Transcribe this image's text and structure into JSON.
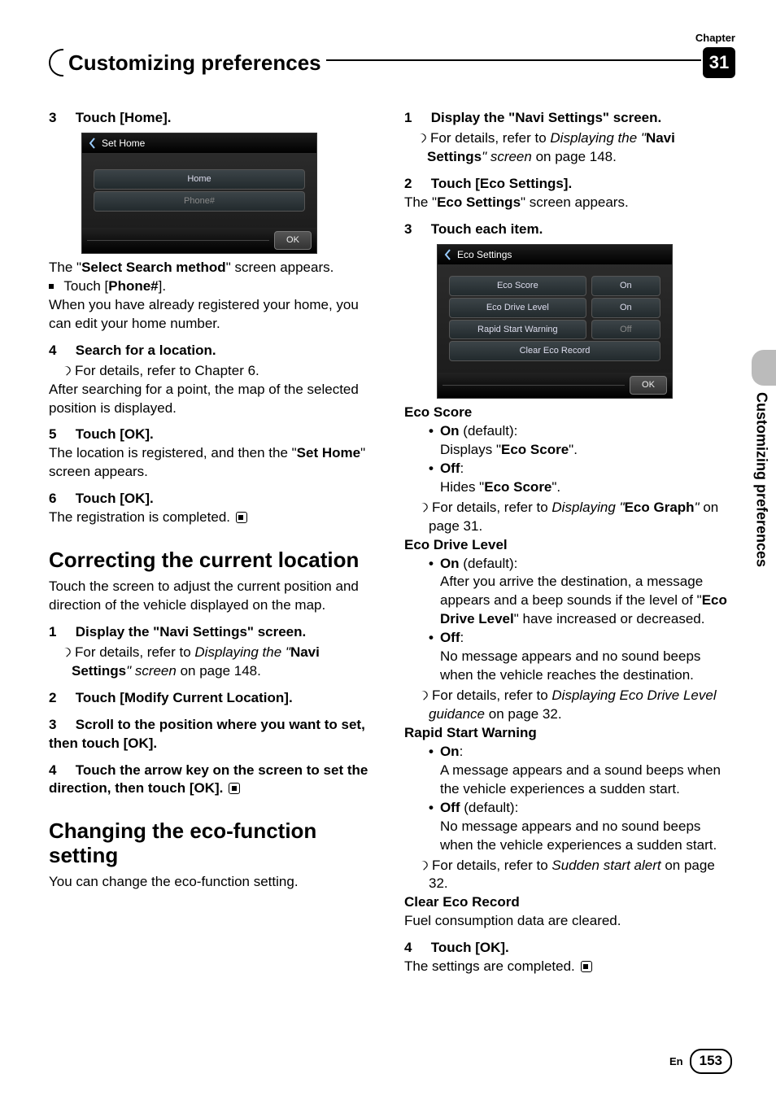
{
  "chapter_label": "Chapter",
  "chapter_number": "31",
  "header_title": "Customizing preferences",
  "side_tab_text": "Customizing preferences",
  "footer_lang": "En",
  "page_number": "153",
  "left": {
    "step3": {
      "num": "3",
      "title": "Touch [Home]."
    },
    "shot1": {
      "title": "Set Home",
      "row1": "Home",
      "row2": "Phone#",
      "ok": "OK"
    },
    "screen_appears": "The \"",
    "screen_appears_bold": "Select Search method",
    "screen_appears_tail": "\" screen appears.",
    "touch_phone": "Touch [",
    "touch_phone_b": "Phone#",
    "touch_phone_tail": "].",
    "note_home": "When you have already registered your home, you can edit your home number.",
    "step4": {
      "num": "4",
      "title": "Search for a location."
    },
    "step4_ref": "For details, refer to Chapter 6.",
    "step4_body": "After searching for a point, the map of the selected position is displayed.",
    "step5": {
      "num": "5",
      "title": "Touch [OK]."
    },
    "step5_body_a": "The location is registered, and then the \"",
    "step5_body_b": "Set Home",
    "step5_body_c": "\" screen appears.",
    "step6": {
      "num": "6",
      "title": "Touch [OK]."
    },
    "step6_body": "The registration is completed.",
    "h2a": "Correcting the current location",
    "h2a_body": "Touch the screen to adjust the current position and direction of the vehicle displayed on the map.",
    "c_step1": {
      "num": "1",
      "title": "Display the \"Navi Settings\" screen."
    },
    "c_step1_a": "For details, refer to ",
    "c_step1_b": "Displaying the \"",
    "c_step1_c": "Navi Settings",
    "c_step1_d": "\" screen",
    "c_step1_e": " on page 148.",
    "c_step2": {
      "num": "2",
      "title": "Touch [Modify Current Location]."
    },
    "c_step3": {
      "num": "3",
      "title": "Scroll to the position where you want to set, then touch [OK]."
    },
    "c_step4": {
      "num": "4",
      "title": "Touch the arrow key on the screen to set the direction, then touch [OK]."
    },
    "h2b": "Changing the eco-function setting",
    "h2b_body": "You can change the eco-function setting."
  },
  "right": {
    "r_step1": {
      "num": "1",
      "title": "Display the \"Navi Settings\" screen."
    },
    "r_step1_a": "For details, refer to ",
    "r_step1_b": "Displaying the \"",
    "r_step1_c": "Navi Settings",
    "r_step1_d": "\" screen",
    "r_step1_e": " on page 148.",
    "r_step2": {
      "num": "2",
      "title": "Touch [Eco Settings]."
    },
    "r_step2_body_a": "The \"",
    "r_step2_body_b": "Eco Settings",
    "r_step2_body_c": "\" screen appears.",
    "r_step3": {
      "num": "3",
      "title": "Touch each item."
    },
    "shot2": {
      "title": "Eco Settings",
      "rows": [
        {
          "label": "Eco Score",
          "val": "On",
          "off": false
        },
        {
          "label": "Eco Drive Level",
          "val": "On",
          "off": false
        },
        {
          "label": "Rapid Start Warning",
          "val": "Off",
          "off": true
        },
        {
          "label": "Clear Eco Record",
          "val": "",
          "off": false
        }
      ],
      "ok": "OK"
    },
    "eco_score_h": "Eco Score",
    "eco_on_a": "On",
    "eco_on_def": " (default):",
    "eco_on_body_a": "Displays \"",
    "eco_on_body_b": "Eco Score",
    "eco_on_body_c": "\".",
    "eco_off": "Off",
    "eco_off_colon": ":",
    "eco_off_body_a": "Hides \"",
    "eco_off_body_b": "Eco Score",
    "eco_off_body_c": "\".",
    "eco_ref_a": "For details, refer to ",
    "eco_ref_b": "Displaying \"",
    "eco_ref_c": "Eco Graph",
    "eco_ref_d": "\"",
    "eco_ref_e": " on page 31.",
    "edl_h": "Eco Drive Level",
    "edl_on": "On",
    "edl_on_def": " (default):",
    "edl_on_body_a": "After you arrive the destination, a message appears and a beep sounds if the level of \"",
    "edl_on_body_b": "Eco Drive Level",
    "edl_on_body_c": "\" have increased or decreased.",
    "edl_off": "Off",
    "edl_off_colon": ":",
    "edl_off_body": "No message appears and no sound beeps when the vehicle reaches the destination.",
    "edl_ref_a": "For details, refer to ",
    "edl_ref_b": "Displaying Eco Drive Level guidance",
    "edl_ref_c": " on page 32.",
    "rsw_h": "Rapid Start Warning",
    "rsw_on": "On",
    "rsw_on_colon": ":",
    "rsw_on_body": "A message appears and a sound beeps when the vehicle experiences a sudden start.",
    "rsw_off": "Off",
    "rsw_off_def": " (default):",
    "rsw_off_body": "No message appears and no sound beeps when the vehicle experiences a sudden start.",
    "rsw_ref_a": "For details, refer to ",
    "rsw_ref_b": "Sudden start alert",
    "rsw_ref_c": " on page 32.",
    "cer_h": "Clear Eco Record",
    "cer_body": "Fuel consumption data are cleared.",
    "r_step4": {
      "num": "4",
      "title": "Touch [OK]."
    },
    "r_step4_body": "The settings are completed."
  }
}
